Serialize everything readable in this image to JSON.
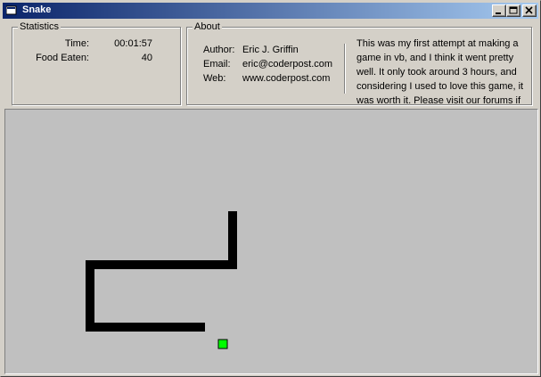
{
  "window": {
    "title": "Snake"
  },
  "statistics": {
    "legend": "Statistics",
    "time_label": "Time:",
    "time_value": "00:01:57",
    "food_label": "Food Eaten:",
    "food_value": "40"
  },
  "about": {
    "legend": "About",
    "author_label": "Author:",
    "author_value": "Eric J. Griffin",
    "email_label": "Email:",
    "email_value": "eric@coderpost.com",
    "web_label": "Web:",
    "web_value": "www.coderpost.com",
    "description": "This was my first attempt at making a game in vb, and I think it went pretty well. It only took around 3 hours, and considering I used to love this game, it was worth it. Please visit our forums if you have any questions or comments."
  },
  "game": {
    "background_color": "#c0c0c0",
    "snake_color": "#000000",
    "food_color": "#00ff00"
  }
}
